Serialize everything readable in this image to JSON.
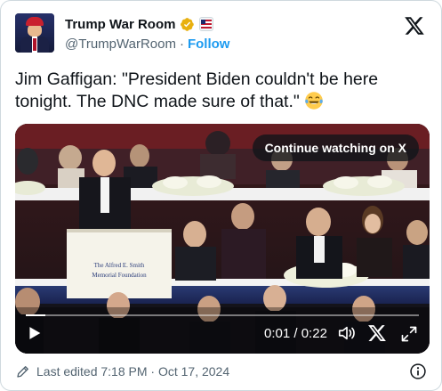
{
  "post": {
    "author": {
      "display_name": "Trump War Room",
      "handle": "@TrumpWarRoom",
      "separator": "·",
      "follow_label": "Follow",
      "affiliate_badge": "🇺🇸",
      "verified_color": "#e8b00f"
    },
    "text": "Jim Gaffigan: \"President Biden couldn't be here tonight. The DNC made sure of that.\"",
    "emoji": "laughing-tears-emoji",
    "video": {
      "continue_label": "Continue watching on X",
      "current_time": "0:01",
      "time_separator": " / ",
      "duration": "0:22",
      "progress": 0.05,
      "lectern_sign": [
        "The Alfred E. Smith",
        "Memorial Foundation"
      ]
    },
    "footer": {
      "edited_label": "Last edited 7:18 PM · Oct 17, 2024"
    }
  },
  "colors": {
    "accent": "#1d9bf0",
    "text": "#0f1419",
    "secondary": "#536471"
  }
}
